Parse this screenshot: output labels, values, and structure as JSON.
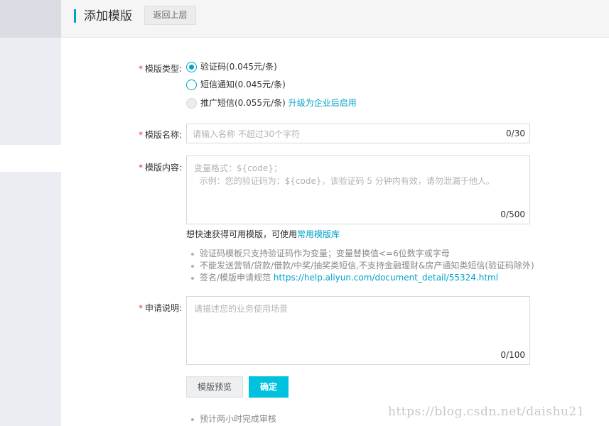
{
  "header": {
    "title": "添加模版",
    "back_label": "返回上层"
  },
  "form": {
    "type_label": "模版类型:",
    "type_options": [
      {
        "label": "验证码(0.045元/条)",
        "state": "checked"
      },
      {
        "label": "短信通知(0.045元/条)",
        "state": "unchecked"
      },
      {
        "label": "推广短信(0.055元/条)",
        "state": "disabled",
        "extra_link": "升级为企业后启用"
      }
    ],
    "name_label": "模版名称:",
    "name_placeholder": "请输入名称 不超过30个字符",
    "name_counter": "0/30",
    "content_label": "模版内容:",
    "content_placeholder": "变量格式：${code}；\n  示例：您的验证码为：${code}，该验证码 5 分钟内有效，请勿泄漏于他人。",
    "content_counter": "0/500",
    "hint_text": "想快速获得可用模版，可使用",
    "hint_link": "常用模版库",
    "tips": [
      "验证码模板只支持验证码作为变量；变量替换值<=6位数字或字母",
      "不能发送营销/贷款/借款/中奖/抽奖类短信,不支持金融理财&房产通知类短信(验证码除外)"
    ],
    "tip_spec_text": "签名/模版申请规范 ",
    "tip_spec_link": "https://help.aliyun.com/document_detail/55324.html",
    "desc_label": "申请说明:",
    "desc_placeholder": "请描述您的业务使用场景",
    "desc_counter": "0/100",
    "preview_label": "模版预览",
    "confirm_label": "确定",
    "bottom_tip": "预计两小时完成审核"
  },
  "watermark": "https://blog.csdn.net/daishu21",
  "colors": {
    "accent": "#00a2ca",
    "confirm_bg": "#00c1de",
    "required": "#e4393c"
  }
}
